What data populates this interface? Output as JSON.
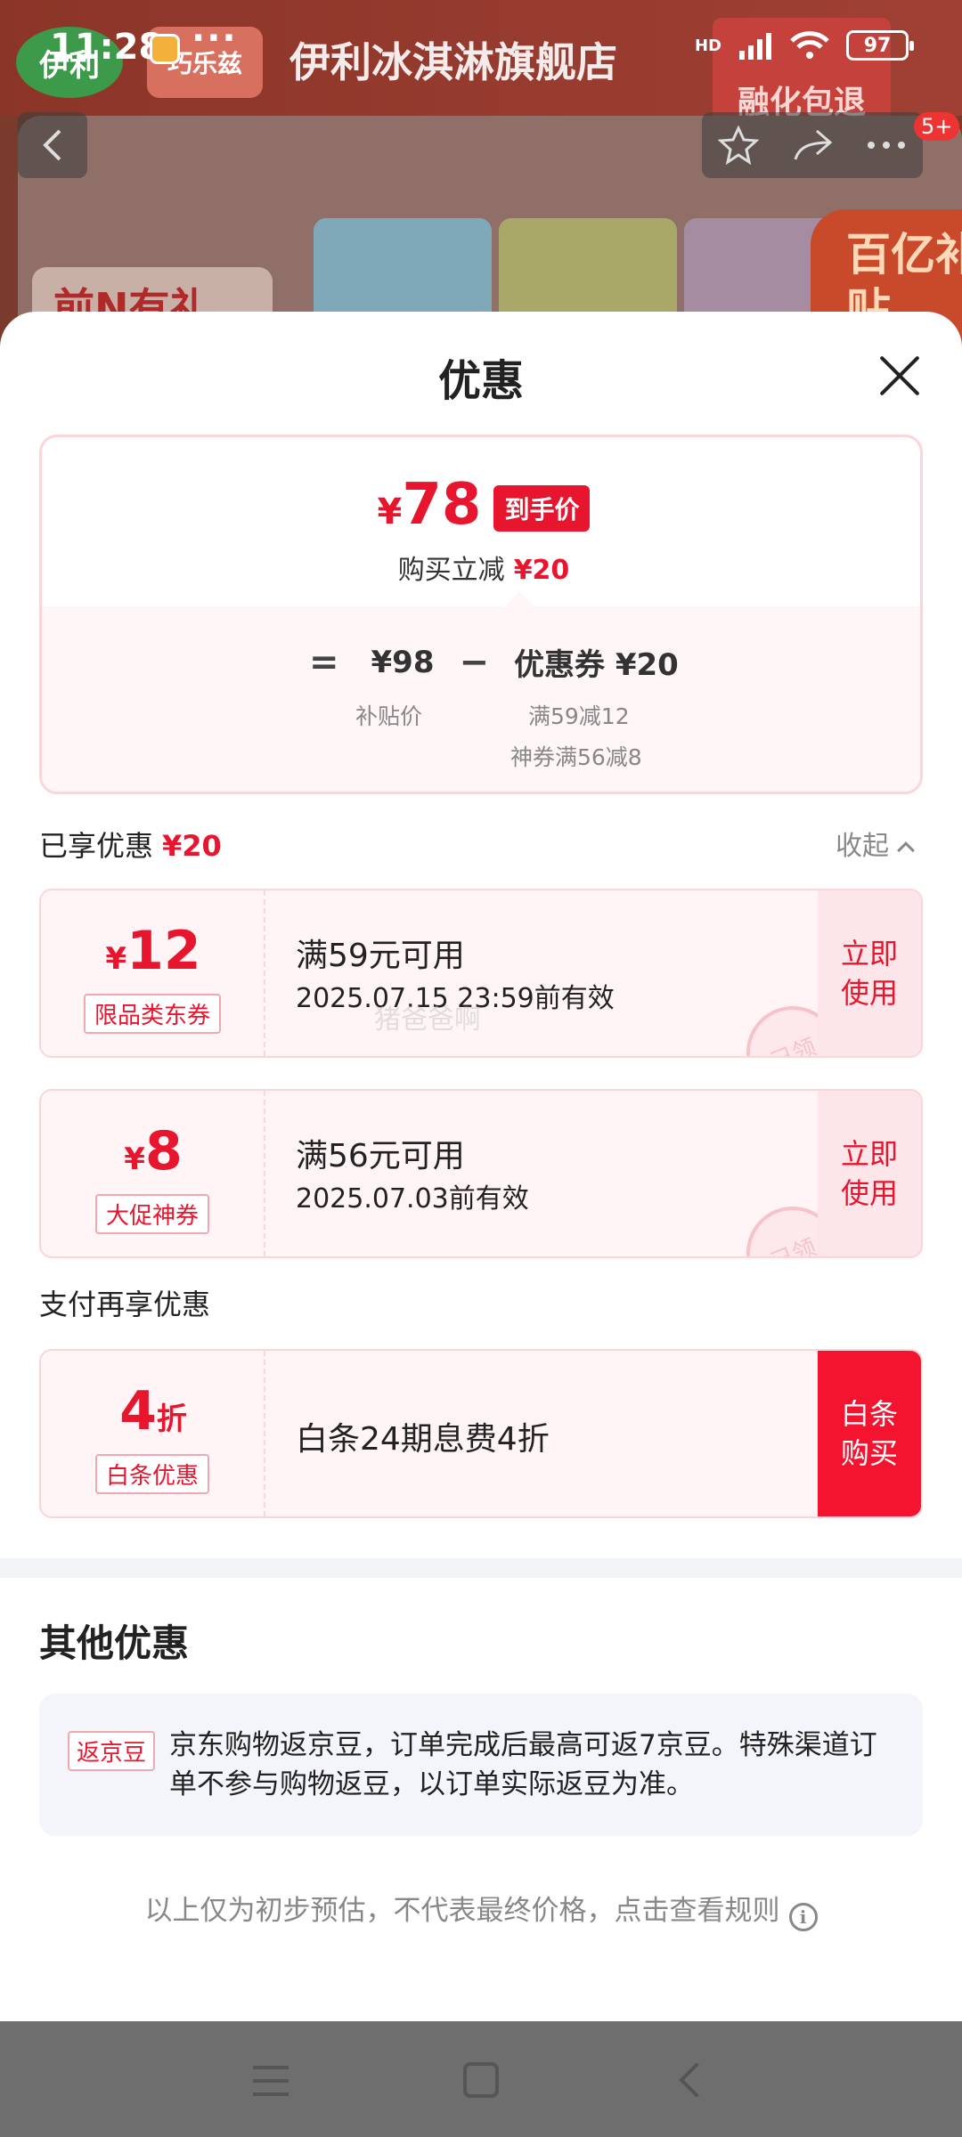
{
  "status_bar": {
    "time": "11:28",
    "more": "···",
    "hd": "HD",
    "battery": "97"
  },
  "background": {
    "brand_logo": "伊利",
    "brand_name": "巧乐兹",
    "store_name": "伊利冰淇淋旗舰店",
    "promo_badge": "融化包退",
    "gift_text": "前N有礼",
    "subsidy_text": "百亿补贴",
    "nav_badge": "5+"
  },
  "sheet": {
    "title": "优惠",
    "summary": {
      "currency": "¥",
      "final_price": "78",
      "final_price_tag": "到手价",
      "reduce_label": "购买立减",
      "reduce_value": "¥20",
      "formula_eq": "=",
      "subsidy_price": "¥98",
      "formula_minus": "−",
      "coupon_total": "优惠券 ¥20",
      "subsidy_label": "补贴价",
      "coupon_detail_1": "满59减12",
      "coupon_detail_2": "神券满56减8"
    },
    "enjoyed": {
      "label": "已享优惠",
      "value": "¥20",
      "collapse": "收起"
    },
    "coupons": [
      {
        "currency": "¥",
        "amount": "12",
        "tag": "限品类东券",
        "condition": "满59元可用",
        "validity": "2025.07.15 23:59前有效",
        "button": "立即\n使用",
        "stamp": "已领"
      },
      {
        "currency": "¥",
        "amount": "8",
        "tag": "大促神券",
        "condition": "满56元可用",
        "validity": "2025.07.03前有效",
        "button": "立即\n使用",
        "stamp": "已领"
      }
    ],
    "watermark": "猪爸爸啊",
    "pay_section": {
      "title": "支付再享优惠",
      "amount": "4",
      "unit": "折",
      "tag": "白条优惠",
      "condition": "白条24期息费4折",
      "button": "白条\n购买"
    },
    "other": {
      "title": "其他优惠",
      "bean_tag": "返京豆",
      "bean_text": "京东购物返京豆，订单完成后最高可返7京豆。特殊渠道订单不参与购物返豆，以订单实际返豆为准。"
    },
    "footnote": "以上仅为初步预估，不代表最终价格，点击查看规则",
    "info_icon": "i"
  },
  "colors": {
    "accent_red": "#e8152e",
    "coupon_bg": "#fff5f6",
    "overlay": "#6e6e6e"
  },
  "icons": [
    "back-arrow-icon",
    "star-icon",
    "share-icon",
    "more-icon",
    "close-icon",
    "chevron-up-icon",
    "info-icon",
    "menu-icon",
    "home-icon",
    "back-icon"
  ]
}
